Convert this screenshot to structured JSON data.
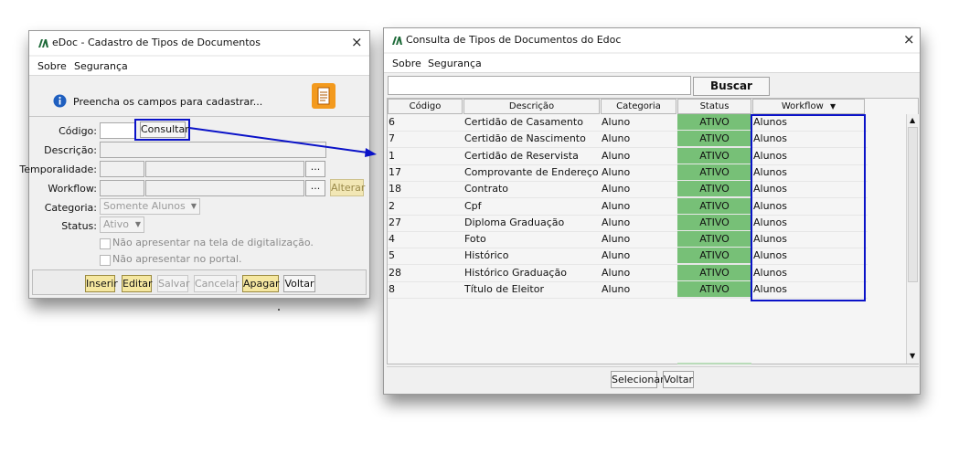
{
  "left_window": {
    "title": "eDoc - Cadastro de Tipos de Documentos",
    "close_glyph": "×",
    "menu": [
      "Sobre",
      "Segurança"
    ],
    "info_text": "Preencha os campos para cadastrar...",
    "labels": {
      "codigo": "Código:",
      "descricao": "Descrição:",
      "temporalidade": "Temporalidade:",
      "workflow": "Workflow:",
      "categoria": "Categoria:",
      "status": "Status:"
    },
    "consultar_button": "Consultar",
    "ellipsis": "...",
    "alterar_button": "Alterar",
    "categoria_value": "Somente Alunos",
    "status_value": "Ativo",
    "checkbox_1": "Não apresentar na tela de digitalização.",
    "checkbox_2": "Não apresentar no portal.",
    "buttons": {
      "inserir": "Inserir",
      "editar": "Editar",
      "salvar": "Salvar",
      "cancelar": "Cancelar",
      "apagar": "Apagar",
      "voltar": "Voltar"
    }
  },
  "right_window": {
    "title": "Consulta de Tipos de Documentos do Edoc",
    "close_glyph": "×",
    "menu": [
      "Sobre",
      "Segurança"
    ],
    "search_value": "",
    "buscar_button": "Buscar",
    "columns": [
      "Código",
      "Descrição",
      "Categoria",
      "Status",
      "Workflow"
    ],
    "workflow_sort_glyph": "▼",
    "rows": [
      {
        "codigo": "6",
        "descricao": "Certidão de Casamento",
        "categoria": "Aluno",
        "status": "ATIVO",
        "workflow": "Alunos"
      },
      {
        "codigo": "7",
        "descricao": "Certidão de Nascimento",
        "categoria": "Aluno",
        "status": "ATIVO",
        "workflow": "Alunos"
      },
      {
        "codigo": "1",
        "descricao": "Certidão de Reservista",
        "categoria": "Aluno",
        "status": "ATIVO",
        "workflow": "Alunos"
      },
      {
        "codigo": "17",
        "descricao": "Comprovante de Endereço",
        "categoria": "Aluno",
        "status": "ATIVO",
        "workflow": "Alunos"
      },
      {
        "codigo": "18",
        "descricao": "Contrato",
        "categoria": "Aluno",
        "status": "ATIVO",
        "workflow": "Alunos"
      },
      {
        "codigo": "2",
        "descricao": "Cpf",
        "categoria": "Aluno",
        "status": "ATIVO",
        "workflow": "Alunos"
      },
      {
        "codigo": "27",
        "descricao": "Diploma Graduação",
        "categoria": "Aluno",
        "status": "ATIVO",
        "workflow": "Alunos"
      },
      {
        "codigo": "4",
        "descricao": "Foto",
        "categoria": "Aluno",
        "status": "ATIVO",
        "workflow": "Alunos"
      },
      {
        "codigo": "5",
        "descricao": "Histórico",
        "categoria": "Aluno",
        "status": "ATIVO",
        "workflow": "Alunos"
      },
      {
        "codigo": "28",
        "descricao": "Histórico Graduação",
        "categoria": "Aluno",
        "status": "ATIVO",
        "workflow": "Alunos"
      },
      {
        "codigo": "8",
        "descricao": "Título de Eleitor",
        "categoria": "Aluno",
        "status": "ATIVO",
        "workflow": "Alunos"
      }
    ],
    "footer_buttons": {
      "selecionar": "Selecionar",
      "voltar": "Voltar"
    }
  },
  "colors": {
    "status_green": "#77c077",
    "highlight_blue": "#0a12c8",
    "button_yellow": "#f5e7a0",
    "document_icon_orange": "#f39a1e"
  },
  "icons": [
    "app-logo-icon",
    "info-icon",
    "document-icon",
    "close-icon",
    "scroll-up-icon",
    "scroll-down-icon",
    "arrow-annotation"
  ]
}
